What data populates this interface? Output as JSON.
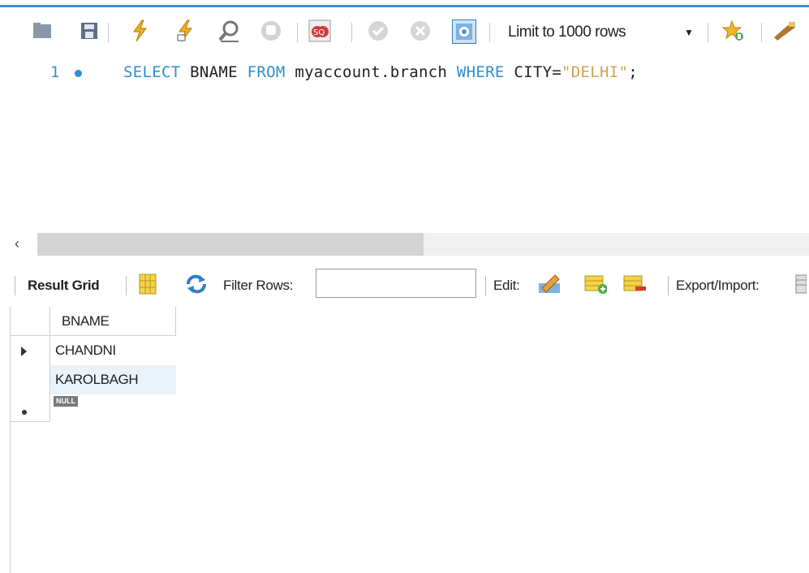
{
  "window": {
    "accent": "#3d8fd6"
  },
  "toolbar": {
    "icons": [
      "folder-icon",
      "save-icon",
      "execute-icon",
      "execute-current-icon",
      "explain-icon",
      "stop-icon",
      "toggle-continue-icon",
      "commit-icon",
      "rollback-icon",
      "autocommit-icon",
      "beautify-icon",
      "wrench-icon"
    ],
    "limit_label": "Limit to 1000 rows"
  },
  "editor": {
    "line_number": "1",
    "sql": {
      "kw_select": "SELECT",
      "col": " BNAME ",
      "kw_from": "FROM",
      "table": " myaccount.branch ",
      "kw_where": "WHERE",
      "cond": " CITY=",
      "value": "\"DELHI\"",
      "end": ";"
    }
  },
  "results": {
    "result_grid_label": "Result Grid",
    "filter_label": "Filter Rows:",
    "filter_value": "",
    "edit_label": "Edit:",
    "export_label": "Export/Import:",
    "column_header": "BNAME",
    "rows": [
      "CHANDNI",
      "KAROLBAGH"
    ],
    "null_label": "NULL"
  },
  "colors": {
    "keyword": "#2d8ecf",
    "string": "#d69f4e",
    "selection": "#eaf2fb"
  }
}
